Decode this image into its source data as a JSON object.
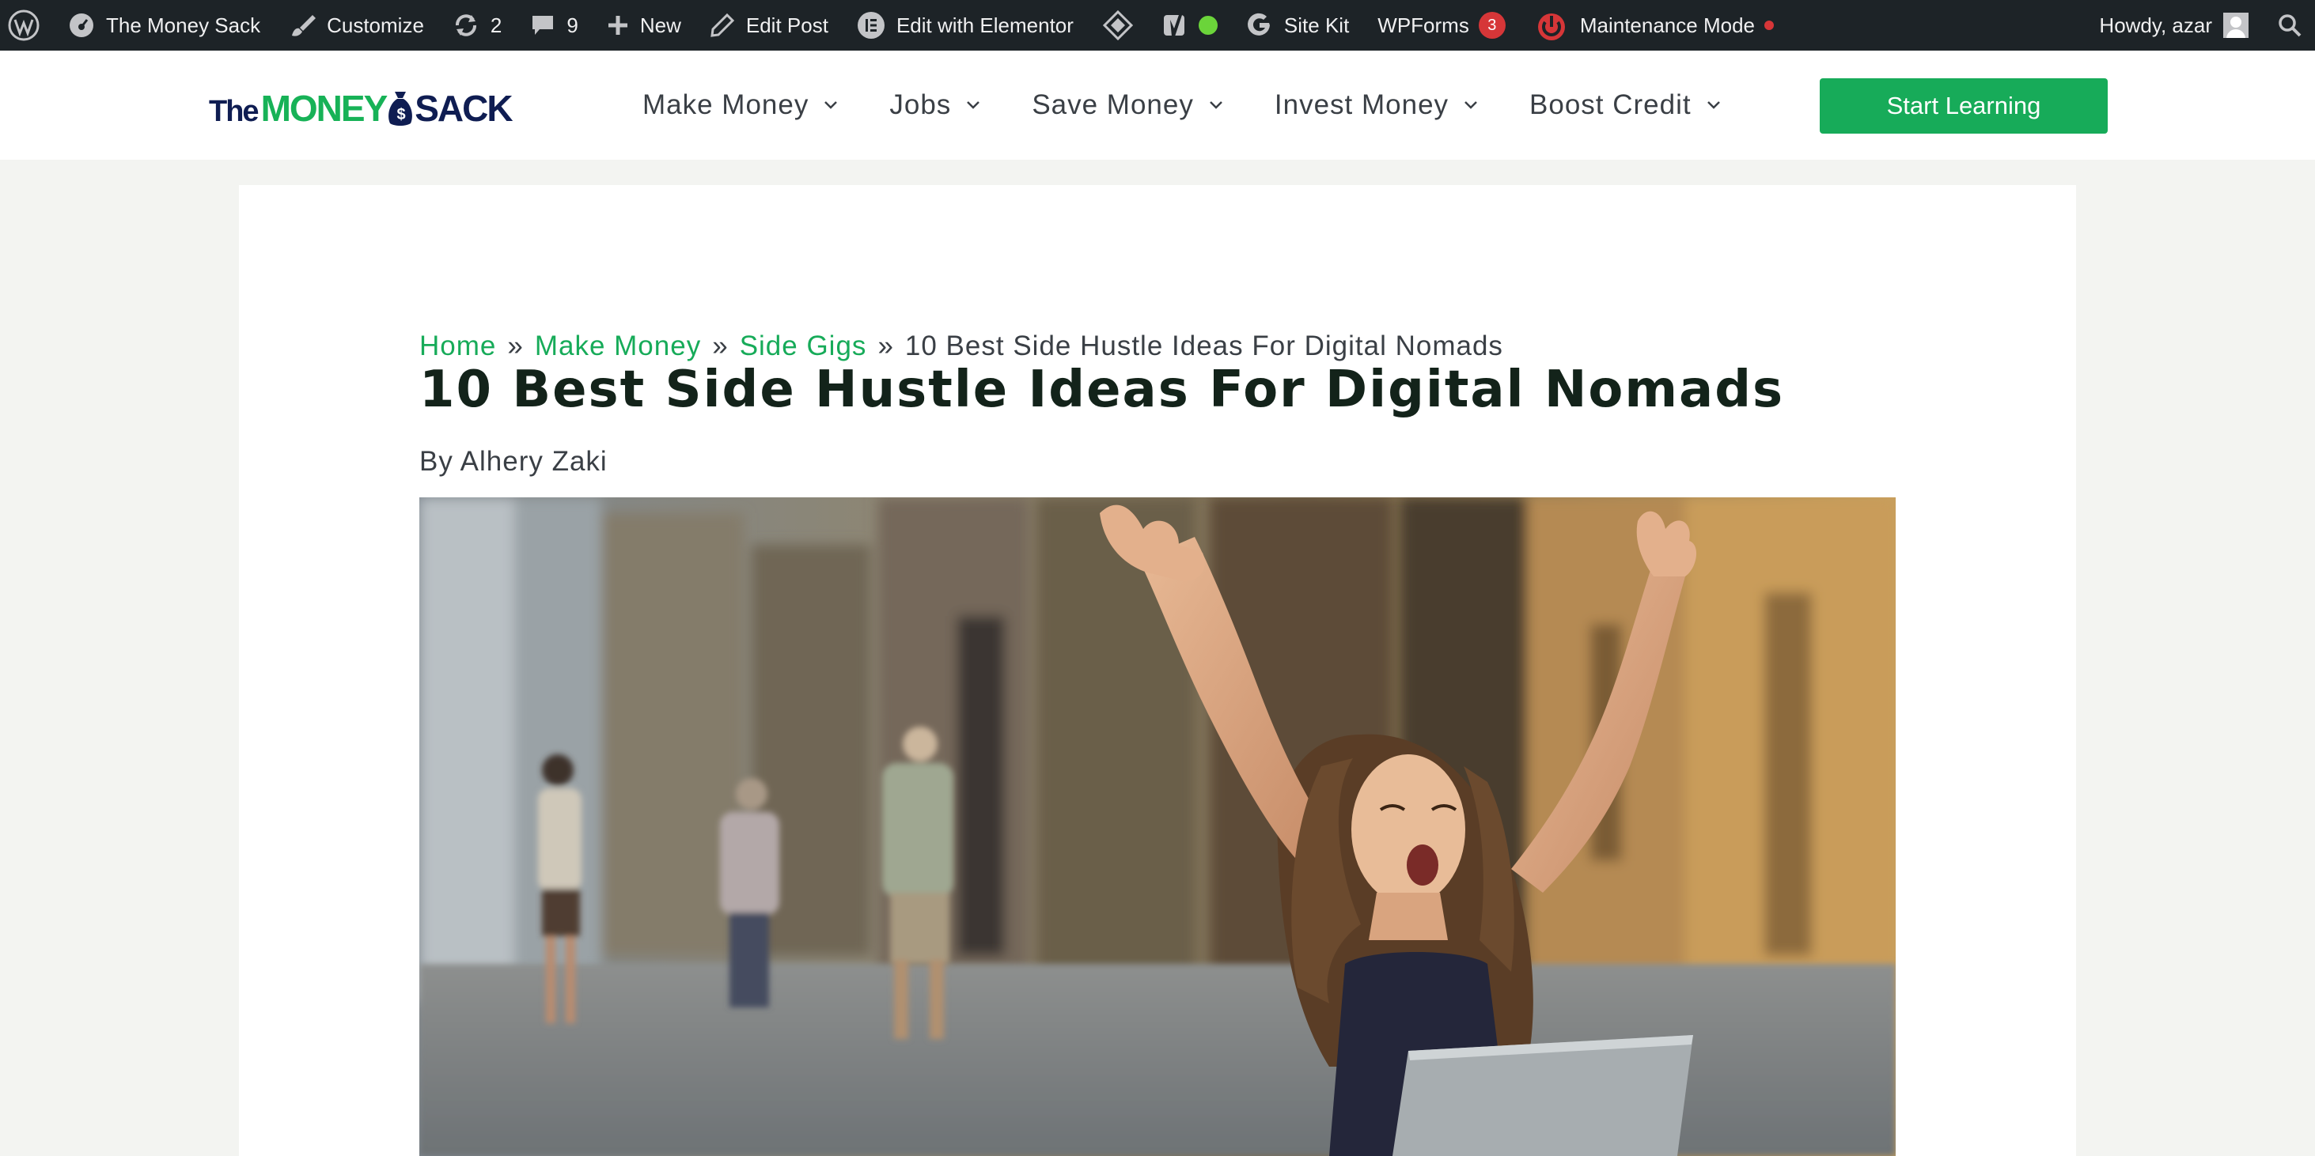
{
  "admin_bar": {
    "site_name": "The Money Sack",
    "customize": "Customize",
    "updates_count": "2",
    "comments_count": "9",
    "new_label": "New",
    "edit_post": "Edit Post",
    "edit_elementor": "Edit with Elementor",
    "site_kit": "Site Kit",
    "wpforms": "WPForms",
    "wpforms_badge": "3",
    "maintenance": "Maintenance Mode",
    "howdy": "Howdy, azar",
    "icons": [
      "wordpress-icon",
      "dashboard-icon",
      "brush-icon",
      "updates-icon",
      "comment-icon",
      "plus-icon",
      "pencil-icon",
      "elementor-icon",
      "diamond-icon",
      "yoast-icon",
      "status-dot-icon",
      "google-icon",
      "maintenance-power-icon",
      "search-icon"
    ]
  },
  "header": {
    "logo": {
      "the": "The",
      "money": "MONEY",
      "sack": "SACK"
    },
    "nav": [
      {
        "label": "Make Money"
      },
      {
        "label": "Jobs"
      },
      {
        "label": "Save Money"
      },
      {
        "label": "Invest Money"
      },
      {
        "label": "Boost Credit"
      }
    ],
    "cta": "Start Learning"
  },
  "post": {
    "breadcrumb": [
      {
        "label": "Home",
        "link": true
      },
      {
        "label": "Make Money",
        "link": true
      },
      {
        "label": "Side Gigs",
        "link": true
      },
      {
        "label": "10 Best Side Hustle Ideas For Digital Nomads",
        "link": false
      }
    ],
    "separator": "»",
    "title": "10 Best Side Hustle Ideas For Digital Nomads",
    "byline": "By Alhery Zaki"
  },
  "colors": {
    "admin_bg": "#1d2327",
    "brand_green": "#17ab59",
    "brand_navy": "#0f1d52",
    "badge_red": "#d63638",
    "page_bg": "#f3f4f1"
  }
}
